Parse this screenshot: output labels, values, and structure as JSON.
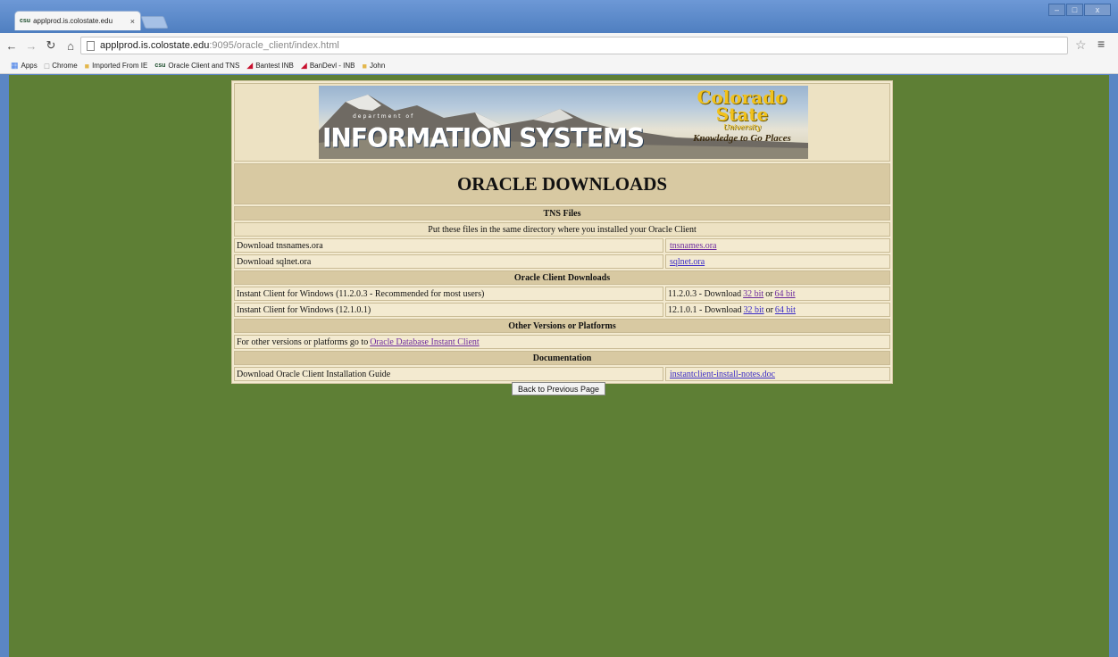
{
  "browser": {
    "tab_title": "applprod.is.colostate.edu",
    "tab_favicon": "csu",
    "close_glyph": "×",
    "url_host": "applprod.is.colostate.edu",
    "url_rest": ":9095/oracle_client/index.html",
    "window_controls": [
      "‒",
      "□",
      "x"
    ],
    "bookmarks": [
      {
        "label": "Apps",
        "icon": "apps-grid"
      },
      {
        "label": "Chrome",
        "icon": "page"
      },
      {
        "label": "Imported From IE",
        "icon": "folder"
      },
      {
        "label": "Oracle Client and TNS",
        "icon": "csu"
      },
      {
        "label": "Bantest INB",
        "icon": "flag"
      },
      {
        "label": "BanDevl - INB",
        "icon": "flag"
      },
      {
        "label": "John",
        "icon": "folder"
      }
    ]
  },
  "banner": {
    "dept_label": "department of",
    "dept_name": "INFORMATION  SYSTEMS",
    "csu_line1": "Colorado",
    "csu_line2": "State",
    "csu_line3": "University",
    "csu_tagline": "Knowledge to Go Places"
  },
  "page": {
    "title": "ORACLE DOWNLOADS",
    "tns": {
      "header": "TNS Files",
      "note": "Put these files in the same directory where you installed your Oracle Client",
      "rows": [
        {
          "label": "Download tnsnames.ora",
          "link": "tnsnames.ora"
        },
        {
          "label": "Download sqlnet.ora",
          "link": "sqlnet.ora"
        }
      ]
    },
    "client": {
      "header": "Oracle Client Downloads",
      "rows": [
        {
          "label": "Instant Client for Windows (11.2.0.3 - Recommended for most users)",
          "prefix": "11.2.0.3 - Download",
          "link32": "32 bit",
          "sep": "or",
          "link64": "64 bit"
        },
        {
          "label": "Instant Client for Windows (12.1.0.1)",
          "prefix": "12.1.0.1 - Download",
          "link32": "32 bit",
          "sep": "or",
          "link64": "64 bit"
        }
      ]
    },
    "other": {
      "header": "Other Versions or Platforms",
      "text": "For other versions or platforms go to",
      "link": "Oracle Database Instant Client"
    },
    "docs": {
      "header": "Documentation",
      "label": "Download Oracle Client Installation Guide",
      "link": "instantclient-install-notes.doc"
    },
    "back_button": "Back to Previous Page"
  },
  "colors": {
    "page_background": "#5e7f35",
    "table_background": "#f3ead0",
    "header_background": "#d8c9a2",
    "link": "#3a2bc7",
    "visited_link": "#6e2c9e"
  }
}
